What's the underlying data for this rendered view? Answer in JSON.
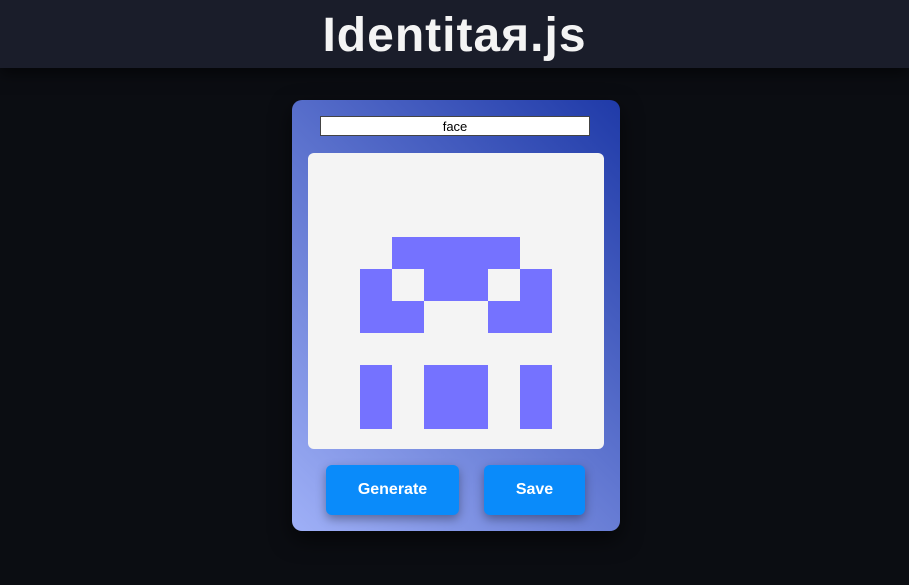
{
  "header": {
    "title": "Identitaя.js"
  },
  "seed": {
    "value": "face"
  },
  "identicon": {
    "grid_columns": 8,
    "pattern": [
      "........",
      "........",
      "..####..",
      ".#.##.#.",
      ".##..##.",
      "........",
      ".#.##.#.",
      ".#.##.#."
    ]
  },
  "buttons": {
    "generate_label": "Generate",
    "save_label": "Save"
  },
  "colors": {
    "page_bg": "#0b0d12",
    "header_bg": "#1a1d2a",
    "card_gradient_start": "#9fb0f7",
    "card_gradient_end": "#1f3aa8",
    "canvas_bg": "#f4f4f4",
    "identicon_fill": "#7572ff",
    "button_bg": "#0a8bfa"
  }
}
